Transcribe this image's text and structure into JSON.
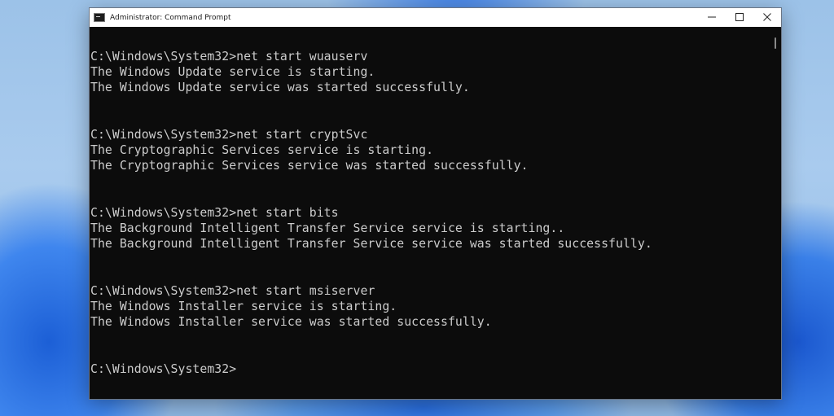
{
  "window": {
    "title": "Administrator: Command Prompt",
    "controls": {
      "minimize": "—",
      "maximize": "☐",
      "close": "✕"
    }
  },
  "console": {
    "lines": [
      "C:\\Windows\\System32>net start wuauserv",
      "The Windows Update service is starting.",
      "The Windows Update service was started successfully.",
      "C:\\Windows\\System32>net start cryptSvc",
      "The Cryptographic Services service is starting.",
      "The Cryptographic Services service was started successfully.",
      "C:\\Windows\\System32>net start bits",
      "The Background Intelligent Transfer Service service is starting..",
      "The Background Intelligent Transfer Service service was started successfully.",
      "C:\\Windows\\System32>net start msiserver",
      "The Windows Installer service is starting.",
      "The Windows Installer service was started successfully.",
      "C:\\Windows\\System32>"
    ]
  },
  "icons": {
    "app": "command-prompt-icon",
    "minimize": "minimize-icon",
    "maximize": "maximize-icon",
    "close": "close-icon"
  }
}
